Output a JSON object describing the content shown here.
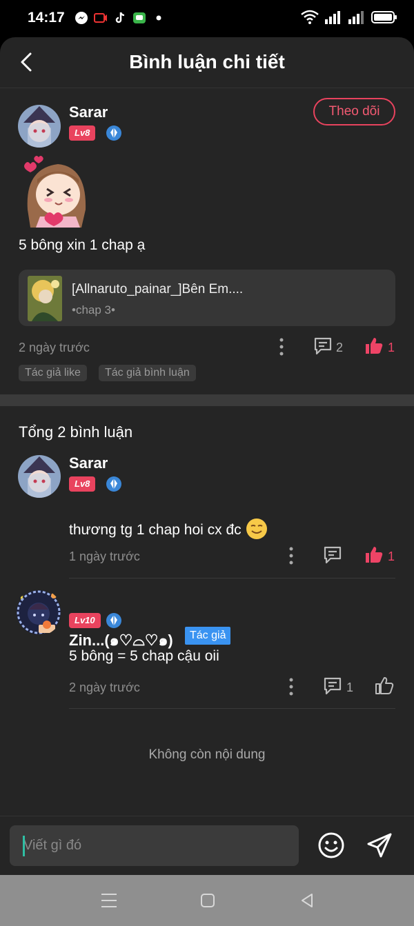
{
  "status_bar": {
    "time": "14:17"
  },
  "header": {
    "title": "Bình luận chi tiết"
  },
  "post": {
    "username": "Sarar",
    "level": "Lv8",
    "follow_label": "Theo dõi",
    "text": "5 bông xin 1 chap ạ",
    "chapter_card": {
      "title": "[Allnaruto_painar_]Bên Em....",
      "subtitle": "•chap 3•"
    },
    "time": "2 ngày trước",
    "comment_count": "2",
    "like_count": "1",
    "tags": [
      "Tác giả like",
      "Tác giả bình luận"
    ]
  },
  "replies_header": {
    "total": "Tổng 2 bình luận"
  },
  "replies": [
    {
      "username": "Sarar",
      "level": "Lv8",
      "text": "thương tg 1 chap hoi cx đc",
      "time": "1 ngày trước",
      "comment_count": "",
      "like_count": "1",
      "liked": true
    },
    {
      "username": "Zin...(๑♡⌓♡๑)",
      "level": "Lv10",
      "author_badge": "Tác giả",
      "text": "5 bông = 5 chap cậu oii",
      "time": "2 ngày trước",
      "comment_count": "1",
      "like_count": "",
      "liked": false
    }
  ],
  "end_note": "Không còn nội dung",
  "input": {
    "placeholder": "Viết gì đó"
  },
  "colors": {
    "accent": "#e9435e",
    "background": "#252525",
    "author_badge": "#3a93f1",
    "level_badge": "#e9435e"
  },
  "icons": [
    "messenger-icon",
    "video-icon",
    "tiktok-icon",
    "message-icon",
    "wifi-icon",
    "signal-icon",
    "battery-icon",
    "back-arrow-icon",
    "diamond-icon",
    "more-dots-icon",
    "comment-icon",
    "thumbs-up-icon",
    "smiley-icon",
    "send-icon",
    "menu-icon",
    "home-icon",
    "back-triangle-icon"
  ]
}
